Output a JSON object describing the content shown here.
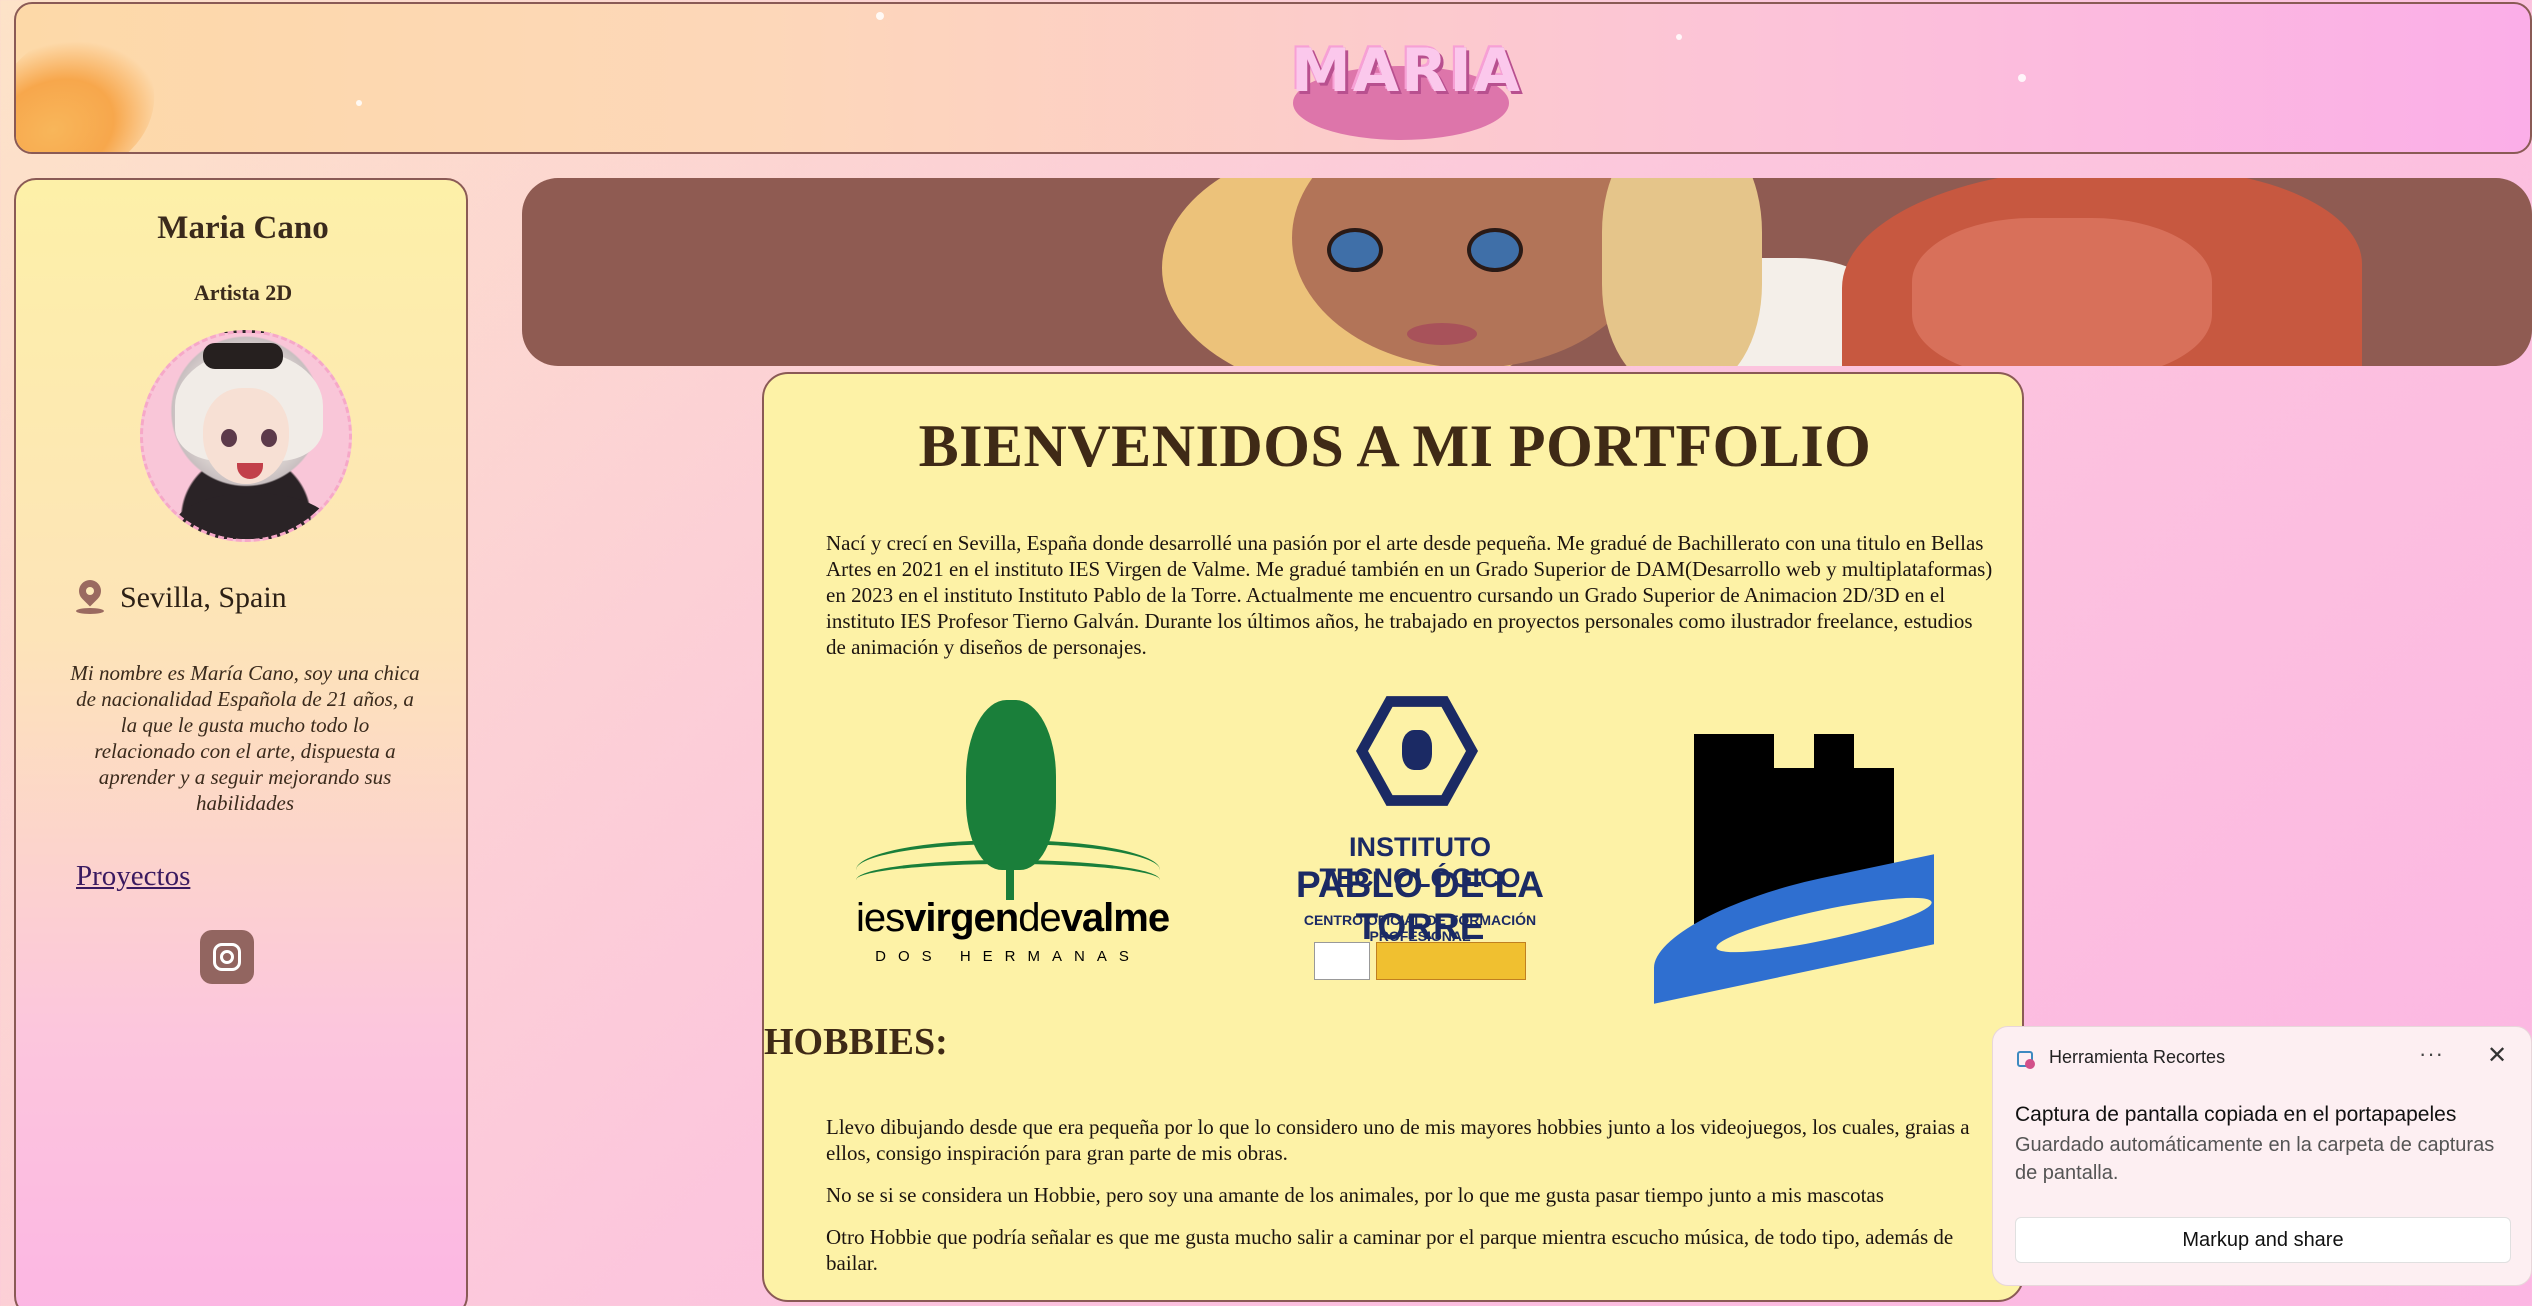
{
  "header": {
    "logo_text": "MARIA"
  },
  "sidebar": {
    "name": "Maria Cano",
    "role": "Artista 2D",
    "location": "Sevilla, Spain",
    "bio": "Mi nombre es María Cano, soy una chica de nacionalidad Española de 21 años, a la que le gusta mucho todo lo relacionado con el arte, dispuesta a aprender y a seguir mejorando sus habilidades",
    "projects_link": "Proyectos"
  },
  "main": {
    "title": "BIENVENIDOS A MI PORTFOLIO",
    "intro": "Nací y crecí en Sevilla, España donde desarrollé una pasión por el arte desde pequeña. Me gradué de Bachillerato con una titulo en Bellas Artes en 2021 en el instituto IES Virgen de Valme. Me gradué también en un Grado Superior de DAM(Desarrollo web y multiplataformas) en 2023 en el instituto Instituto Pablo de la Torre. Actualmente me encuentro cursando un Grado Superior de Animacion 2D/3D en el instituto IES Profesor Tierno Galván. Durante los últimos años, he trabajado en proyectos personales como ilustrador freelance, estudios de animación y diseños de personajes.",
    "logos": {
      "valme_line1_a": "ies",
      "valme_line1_b": "virgen",
      "valme_line1_c": "de",
      "valme_line1_d": "valme",
      "valme_line2": "DOS HERMANAS",
      "pablo_line1": "INSTITUTO TECNOLÓGICO",
      "pablo_line2": "PABLO DE LA TORRE",
      "pablo_line3": "CENTRO OFICIAL DE FORMACIÓN PROFESIONAL"
    },
    "hobbies_title": "HOBBIES:",
    "hobbies": [
      "Llevo dibujando desde que era pequeña por lo que lo considero uno de mis mayores hobbies junto a los videojuegos, los cuales, graias a ellos, consigo inspiración para gran parte de mis obras.",
      "No se si se considera un Hobbie, pero soy una amante de los animales, por lo que me gusta pasar tiempo junto a mis mascotas",
      "Otro Hobbie que podría señalar es que me gusta mucho salir a caminar por el parque mientra escucho música, de todo tipo, además de bailar."
    ]
  },
  "toast": {
    "app_name": "Herramienta Recortes",
    "more_icon": "more-icon",
    "more_glyph": "···",
    "close_glyph": "✕",
    "message": "Captura de pantalla copiada en el portapapeles",
    "subtext": "Guardado automáticamente en la carpeta de capturas de pantalla.",
    "button": "Markup and share"
  },
  "colors": {
    "card_border": "#8a5a55",
    "main_bg": "#fdf2a6",
    "banner_bg": "#8f5b52",
    "link": "#3a1a60"
  }
}
